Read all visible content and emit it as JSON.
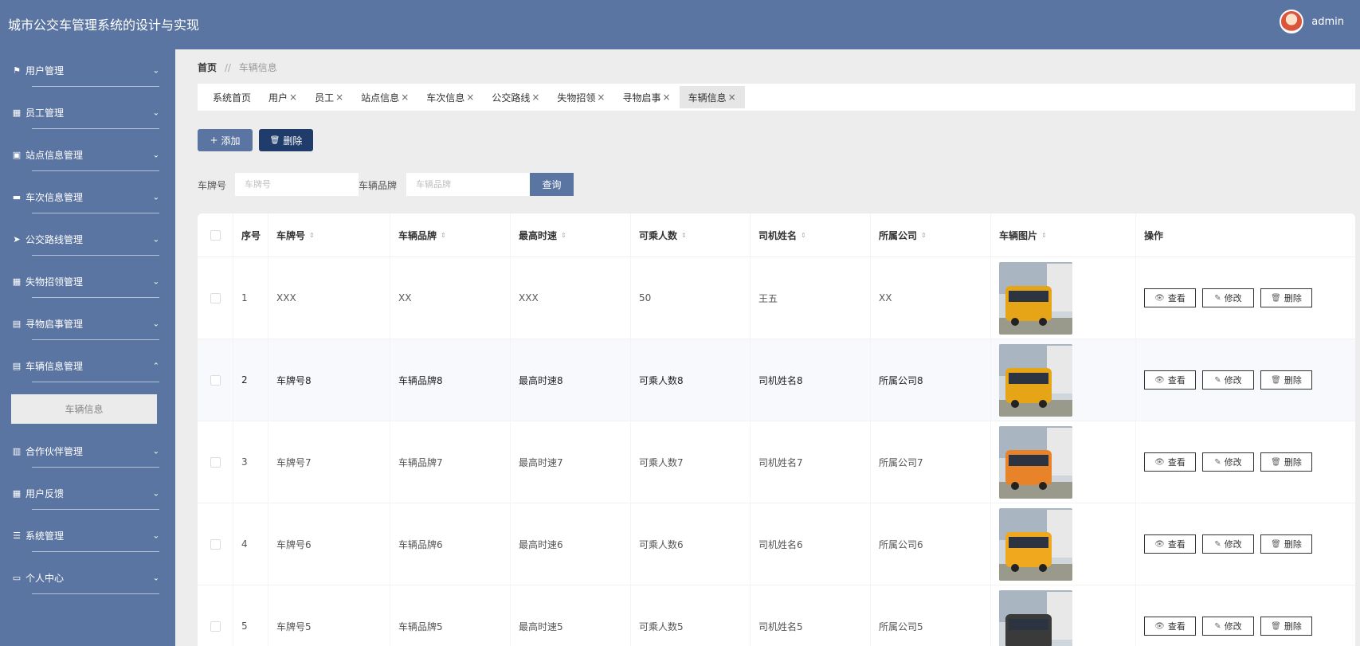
{
  "header": {
    "title": "城市公交车管理系统的设计与实现",
    "username": "admin"
  },
  "sidebar": {
    "items": [
      {
        "label": "用户管理",
        "icon": "flag-icon",
        "glyph": "⚑",
        "chev": "⌄"
      },
      {
        "label": "员工管理",
        "icon": "grid-icon",
        "glyph": "▦",
        "chev": "⌄"
      },
      {
        "label": "站点信息管理",
        "icon": "briefcase-icon",
        "glyph": "▣",
        "chev": "⌄"
      },
      {
        "label": "车次信息管理",
        "icon": "ticket-icon",
        "glyph": "▬",
        "chev": "⌄"
      },
      {
        "label": "公交路线管理",
        "icon": "send-icon",
        "glyph": "➤",
        "chev": "⌄"
      },
      {
        "label": "失物招领管理",
        "icon": "grid-icon",
        "glyph": "▦",
        "chev": "⌄"
      },
      {
        "label": "寻物启事管理",
        "icon": "clipboard-icon",
        "glyph": "▤",
        "chev": "⌄"
      },
      {
        "label": "车辆信息管理",
        "icon": "clipboard-icon",
        "glyph": "▤",
        "chev": "⌃"
      },
      {
        "label": "合作伙伴管理",
        "icon": "chart-icon",
        "glyph": "▥",
        "chev": "⌄"
      },
      {
        "label": "用户反馈",
        "icon": "table-icon",
        "glyph": "▦",
        "chev": "⌄"
      },
      {
        "label": "系统管理",
        "icon": "list-icon",
        "glyph": "☰",
        "chev": "⌄"
      },
      {
        "label": "个人中心",
        "icon": "window-icon",
        "glyph": "▭",
        "chev": "⌄"
      }
    ],
    "active_sub": "车辆信息"
  },
  "breadcrumb": {
    "home": "首页",
    "sep": "//",
    "current": "车辆信息"
  },
  "tabs": [
    {
      "label": "系统首页",
      "close": ""
    },
    {
      "label": "用户",
      "close": "×"
    },
    {
      "label": "员工",
      "close": "×"
    },
    {
      "label": "站点信息",
      "close": "×"
    },
    {
      "label": "车次信息",
      "close": "×"
    },
    {
      "label": "公交路线",
      "close": "×"
    },
    {
      "label": "失物招领",
      "close": "×"
    },
    {
      "label": "寻物启事",
      "close": "×"
    },
    {
      "label": "车辆信息",
      "close": "×"
    }
  ],
  "toolbar": {
    "add_label": "添加",
    "delete_label": "删除",
    "plus": "+",
    "trash": "🗑"
  },
  "search": {
    "plate_label": "车牌号",
    "plate_placeholder": "车牌号",
    "brand_label": "车辆品牌",
    "brand_placeholder": "车辆品牌",
    "query_label": "查询"
  },
  "table": {
    "headers": [
      "序号",
      "车牌号",
      "车辆品牌",
      "最高时速",
      "可乘人数",
      "司机姓名",
      "所属公司",
      "车辆图片",
      "操作"
    ],
    "sort_glyph": "⇕",
    "actions": {
      "view": "查看",
      "edit": "修改",
      "delete": "删除"
    },
    "rows": [
      {
        "idx": "1",
        "plate": "XXX",
        "brand": "XX",
        "speed": "XXX",
        "passengers": "50",
        "driver": "王五",
        "company": "XX",
        "bus_color": "#e6a516"
      },
      {
        "idx": "2",
        "plate": "车牌号8",
        "brand": "车辆品牌8",
        "speed": "最高时速8",
        "passengers": "可乘人数8",
        "driver": "司机姓名8",
        "company": "所属公司8",
        "bus_color": "#e6a516"
      },
      {
        "idx": "3",
        "plate": "车牌号7",
        "brand": "车辆品牌7",
        "speed": "最高时速7",
        "passengers": "可乘人数7",
        "driver": "司机姓名7",
        "company": "所属公司7",
        "bus_color": "#e8832a"
      },
      {
        "idx": "4",
        "plate": "车牌号6",
        "brand": "车辆品牌6",
        "speed": "最高时速6",
        "passengers": "可乘人数6",
        "driver": "司机姓名6",
        "company": "所属公司6",
        "bus_color": "#f0a81e"
      },
      {
        "idx": "5",
        "plate": "车牌号5",
        "brand": "车辆品牌5",
        "speed": "最高时速5",
        "passengers": "可乘人数5",
        "driver": "司机姓名5",
        "company": "所属公司5",
        "bus_color": "#3a3a3a"
      }
    ]
  },
  "colors": {
    "primary": "#5b75a2",
    "danger_dark": "#1f3c6b"
  }
}
